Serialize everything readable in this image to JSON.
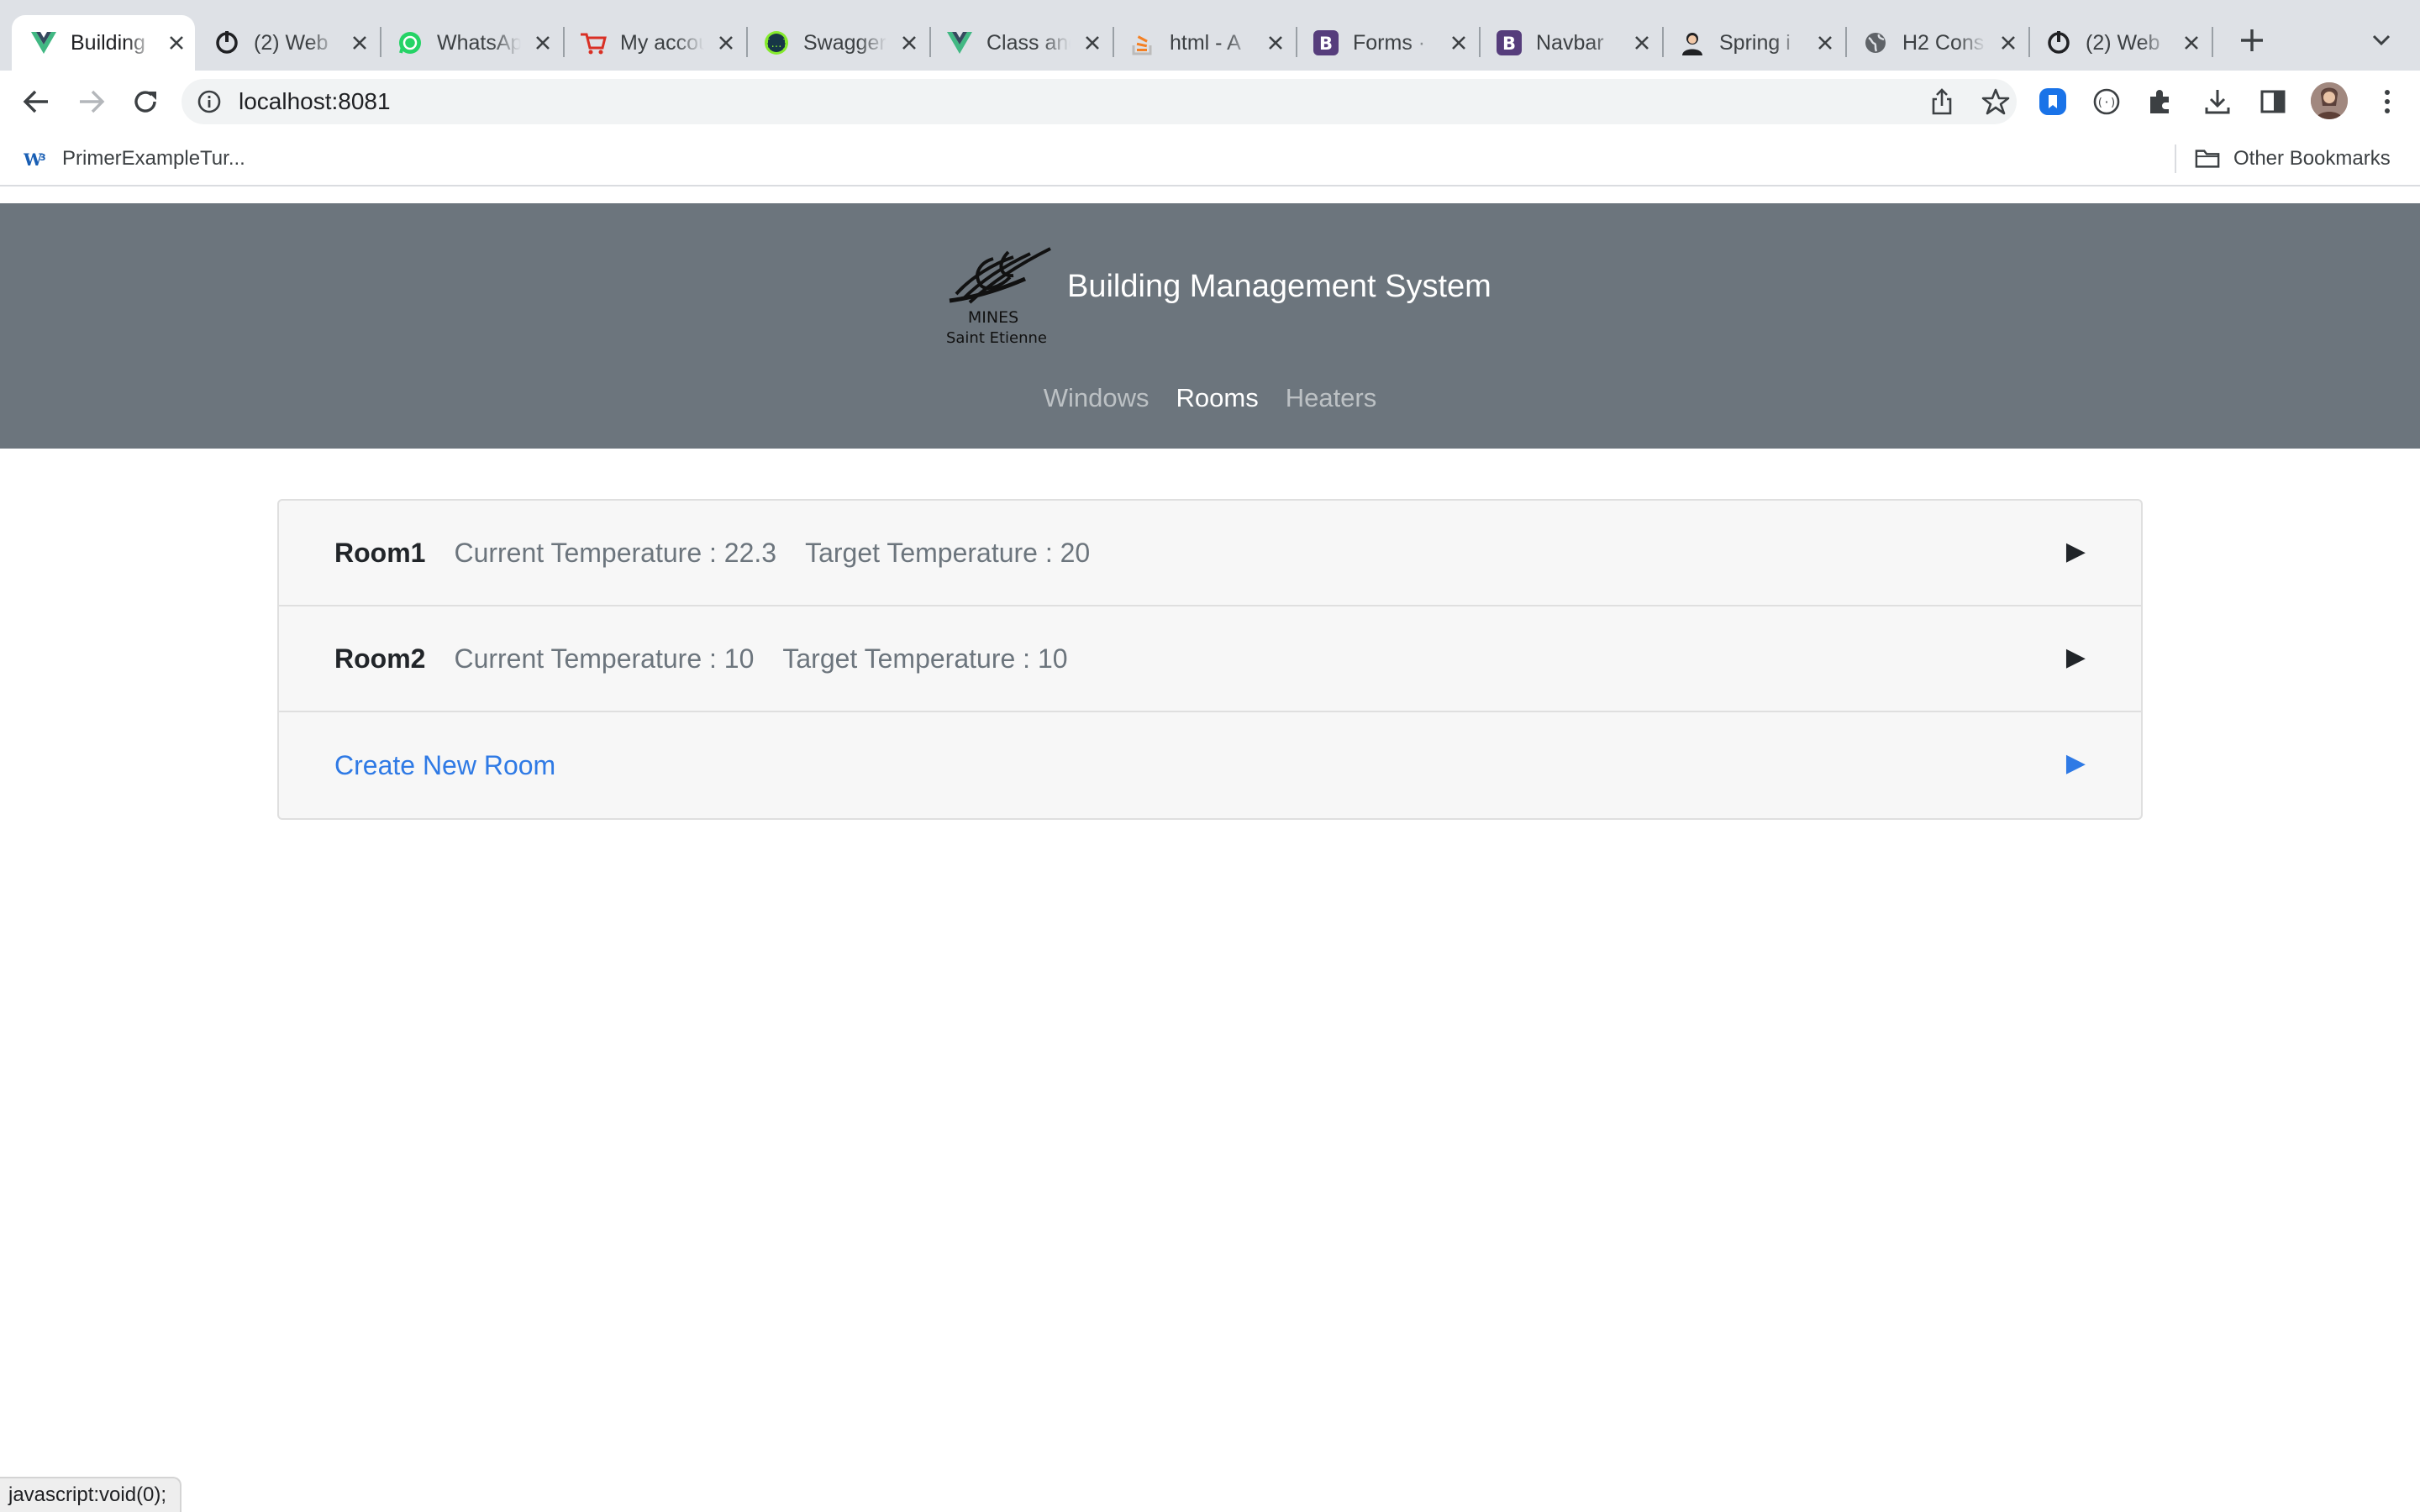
{
  "browser": {
    "tabs": [
      {
        "title": "Building",
        "icon": "vue-icon",
        "active": true
      },
      {
        "title": "(2) Web",
        "icon": "power-icon"
      },
      {
        "title": "WhatsApp",
        "icon": "whatsapp-icon"
      },
      {
        "title": "My account",
        "icon": "cart-icon"
      },
      {
        "title": "Swagger",
        "icon": "swagger-icon"
      },
      {
        "title": "Class and",
        "icon": "vue-icon"
      },
      {
        "title": "html - A",
        "icon": "stackoverflow-icon"
      },
      {
        "title": "Forms ·",
        "icon": "bootstrap-icon"
      },
      {
        "title": "Navbar",
        "icon": "bootstrap-icon"
      },
      {
        "title": "Spring i",
        "icon": "spring-avatar-icon"
      },
      {
        "title": "H2 Cons",
        "icon": "globe-icon"
      },
      {
        "title": "(2) Web",
        "icon": "power-icon"
      }
    ],
    "url": "localhost:8081",
    "bookmarks": {
      "primer": "PrimerExampleTur...",
      "other": "Other Bookmarks"
    },
    "status_text": "javascript:void(0);"
  },
  "app": {
    "title": "Building Management System",
    "logo_text_1": "MINES",
    "logo_text_2": "Saint Etienne",
    "nav": [
      {
        "label": "Windows",
        "active": false
      },
      {
        "label": "Rooms",
        "active": true
      },
      {
        "label": "Heaters",
        "active": false
      }
    ],
    "rooms": [
      {
        "name": "Room1",
        "current": "Current Temperature : 22.3",
        "target": "Target Temperature : 20"
      },
      {
        "name": "Room2",
        "current": "Current Temperature : 10",
        "target": "Target Temperature : 10"
      }
    ],
    "create_label": "Create New Room",
    "arrow": "▶"
  },
  "colors": {
    "header_bg": "#6c757d",
    "link": "#2f7ae5",
    "tabstrip_bg": "#dee1e6"
  }
}
